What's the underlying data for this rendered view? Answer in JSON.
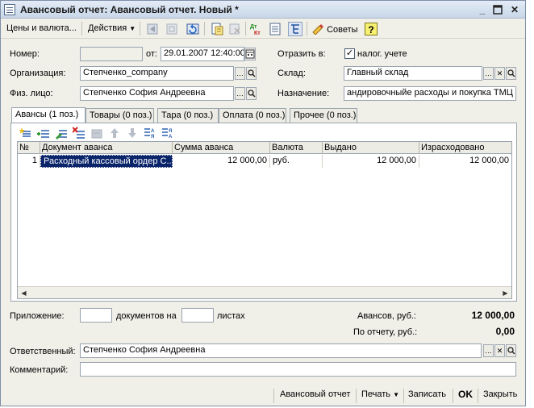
{
  "window": {
    "title": "Авансовый отчет: Авансовый отчет. Новый *"
  },
  "toolbar": {
    "prices_label": "Цены и валюта...",
    "actions_label": "Действия",
    "tips_label": "Советы",
    "help_label": "?"
  },
  "form": {
    "number_label": "Номер:",
    "number_value": "",
    "date_label": "от:",
    "date_value": "29.01.2007 12:40:00",
    "reflect_label": "Отразить в:",
    "tax_label": "налог. учете",
    "tax_checked": true,
    "org_label": "Организация:",
    "org_value": "Степченко_company",
    "warehouse_label": "Склад:",
    "warehouse_value": "Главный склад",
    "person_label": "Физ. лицо:",
    "person_value": "Степченко София Андреевна",
    "purpose_label": "Назначение:",
    "purpose_value": "андировочныйе расходы и покупка ТМЦ"
  },
  "tabs": [
    {
      "label": "Авансы (1 поз.)",
      "active": true
    },
    {
      "label": "Товары (0 поз.)",
      "active": false
    },
    {
      "label": "Тара (0 поз.)",
      "active": false
    },
    {
      "label": "Оплата (0 поз.)",
      "active": false
    },
    {
      "label": "Прочее (0 поз.)",
      "active": false
    }
  ],
  "table": {
    "columns": [
      "№",
      "Документ аванса",
      "Сумма аванса",
      "Валюта",
      "Выдано",
      "Израсходовано"
    ],
    "rows": [
      [
        "1",
        "Расходный кассовый ордер С...",
        "12 000,00",
        "руб.",
        "12 000,00",
        "12 000,00"
      ]
    ]
  },
  "attachment": {
    "label": "Приложение:",
    "docs_value": "",
    "docs_label": "документов на",
    "sheets_value": "",
    "sheets_label": "листах"
  },
  "totals": {
    "advances_label": "Авансов, руб.:",
    "advances_value": "12 000,00",
    "report_label": "По отчету, руб.:",
    "report_value": "0,00"
  },
  "responsible": {
    "label": "Ответственный:",
    "value": "Степченко София Андреевна"
  },
  "comment": {
    "label": "Комментарий:",
    "value": ""
  },
  "bottom": {
    "report_btn": "Авансовый отчет",
    "print_btn": "Печать",
    "save_btn": "Записать",
    "ok_btn": "OK",
    "close_btn": "Закрыть"
  },
  "icons": [
    "document-icon",
    "minimize-icon",
    "maximize-icon",
    "close-icon",
    "chevron-down-icon",
    "first-record-icon",
    "structure-icon",
    "refresh-icon",
    "copy-doc-icon",
    "delete-doc-icon",
    "dt-kt-icon",
    "journal-icon",
    "toggle-structure-icon",
    "tips-icon",
    "help-icon",
    "calendar-icon",
    "ellipsis-icon",
    "search-icon",
    "clear-icon",
    "add-row-icon",
    "copy-row-icon",
    "edit-row-icon",
    "delete-row-icon",
    "end-edit-icon",
    "move-up-icon",
    "move-down-icon",
    "sort-asc-icon",
    "sort-desc-icon"
  ],
  "colors": {
    "selection": "#0a246a",
    "window_bg": "#f0efe8",
    "accent_green": "#3a8a2a",
    "accent_red": "#c02020"
  }
}
